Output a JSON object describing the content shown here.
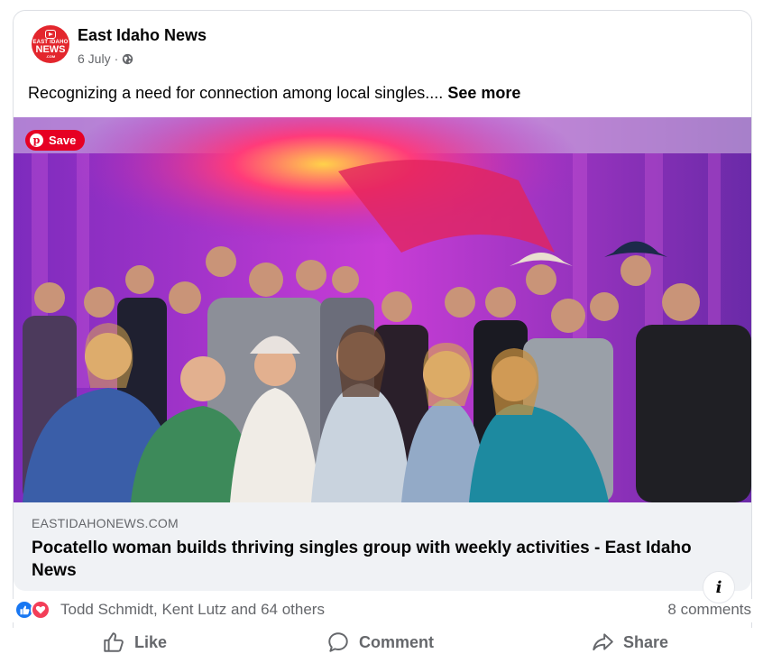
{
  "post": {
    "page_name": "East Idaho News",
    "avatar": {
      "line1": "EAST IDAHO",
      "line2": "NEWS",
      "line3": ".COM"
    },
    "time": "6 July",
    "separator": "·",
    "privacy_icon": "globe-icon",
    "text": "Recognizing a need for connection among local singles....",
    "see_more": "See more"
  },
  "media": {
    "save_label": "Save",
    "save_icon": "pinterest-icon",
    "info_label": "i"
  },
  "link": {
    "domain": "EASTIDAHONEWS.COM",
    "title": "Pocatello woman builds thriving singles group with weekly activities - East Idaho News"
  },
  "engagement": {
    "reaction_icons": [
      "like-icon",
      "love-icon"
    ],
    "reactors": "Todd Schmidt, Kent Lutz and 64 others",
    "comments": "8 comments"
  },
  "actions": {
    "like": "Like",
    "comment": "Comment",
    "share": "Share"
  },
  "colors": {
    "brand_red": "#e3262d",
    "pinterest_red": "#e60023",
    "like_blue": "#1877f2",
    "love_red": "#f33e58",
    "secondary_text": "#65676b"
  }
}
